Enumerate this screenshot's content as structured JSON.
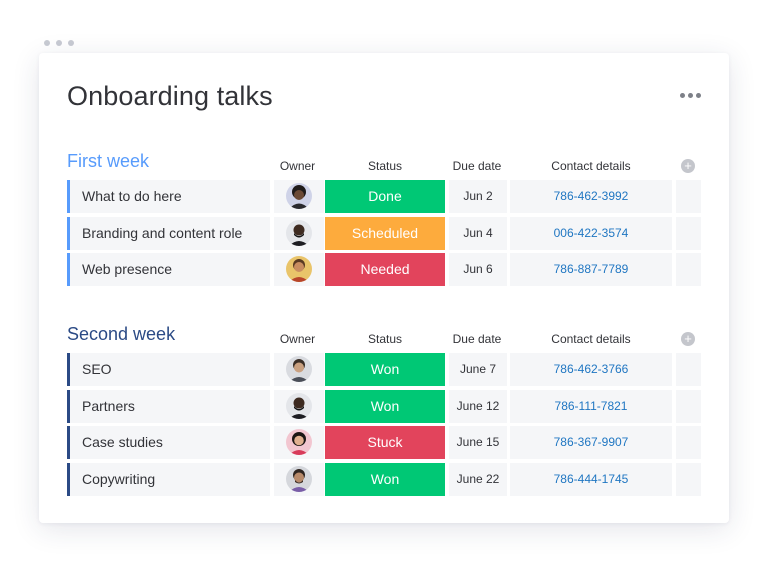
{
  "title": "Onboarding talks",
  "colors": {
    "done": "#00c875",
    "scheduled": "#fdab3d",
    "needed": "#e2445c",
    "won": "#00c875",
    "stuck": "#e2445c",
    "group1": "#579bfc",
    "group2": "#2b4a85"
  },
  "columns": {
    "owner": "Owner",
    "status": "Status",
    "due": "Due date",
    "contact": "Contact details"
  },
  "groups": [
    {
      "title": "First week",
      "rows": [
        {
          "name": "What to do here",
          "owner_icon": "avatar-icon",
          "status": "Done",
          "status_color": "#00c875",
          "due": "Jun 2",
          "contact": "786-462-3992"
        },
        {
          "name": "Branding and content role",
          "owner_icon": "avatar-icon",
          "status": "Scheduled",
          "status_color": "#fdab3d",
          "due": "Jun 4",
          "contact": "006-422-3574"
        },
        {
          "name": "Web presence",
          "owner_icon": "avatar-icon",
          "status": "Needed",
          "status_color": "#e2445c",
          "due": "Jun 6",
          "contact": "786-887-7789"
        }
      ]
    },
    {
      "title": "Second week",
      "rows": [
        {
          "name": "SEO",
          "owner_icon": "avatar-icon",
          "status": "Won",
          "status_color": "#00c875",
          "due": "June 7",
          "contact": "786-462-3766"
        },
        {
          "name": "Partners",
          "owner_icon": "avatar-icon",
          "status": "Won",
          "status_color": "#00c875",
          "due": "June 12",
          "contact": "786-111-7821"
        },
        {
          "name": "Case studies",
          "owner_icon": "avatar-icon",
          "status": "Stuck",
          "status_color": "#e2445c",
          "due": "June 15",
          "contact": "786-367-9907"
        },
        {
          "name": "Copywriting",
          "owner_icon": "avatar-icon",
          "status": "Won",
          "status_color": "#00c875",
          "due": "June 22",
          "contact": "786-444-1745"
        }
      ]
    }
  ]
}
